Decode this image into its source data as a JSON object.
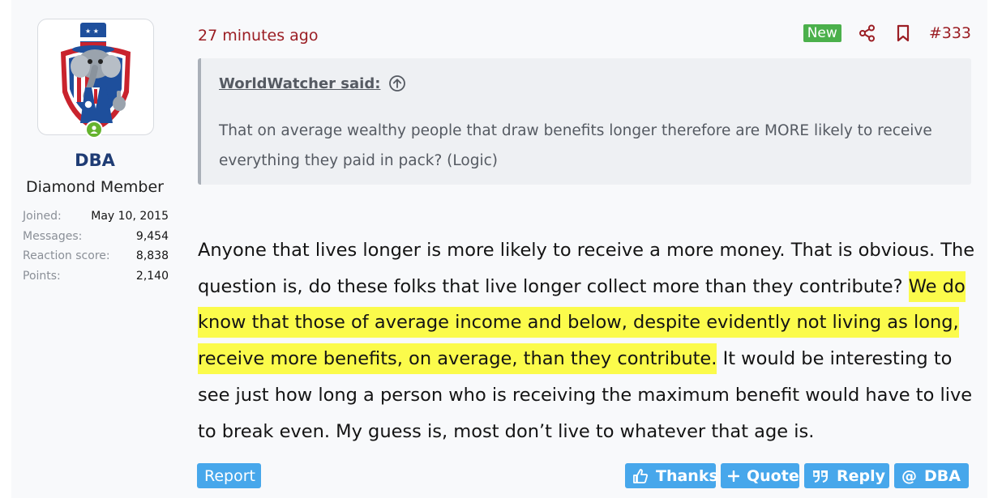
{
  "user": {
    "username": "DBA",
    "title": "Diamond Member",
    "stats": [
      {
        "label": "Joined:",
        "value": "May 10, 2015"
      },
      {
        "label": "Messages:",
        "value": "9,454"
      },
      {
        "label": "Reaction score:",
        "value": "8,838"
      },
      {
        "label": "Points:",
        "value": "2,140"
      }
    ]
  },
  "post": {
    "time": "27 minutes ago",
    "badge": "New",
    "number": "#333",
    "quote": {
      "author": "WorldWatcher said:",
      "text": "That on average wealthy people that draw benefits longer therefore are MORE likely to receive everything they paid in pack? (Logic)"
    },
    "message": {
      "before": "Anyone that lives longer is more likely to receive a more money. That is obvious. The question is, do these folks that live longer collect more than they contribute?",
      "highlighted": "We do know that those of average income and below, despite evidently not living as long, receive more benefits, on average, than they contribute.",
      "after": "It would be interesting to see just how long a person who is receiving the maximum benefit would have to live to break even. My guess is, most don’t live to whatever that age is."
    }
  },
  "footer": {
    "report": "Report",
    "thanks": "Thanks",
    "quote": "Quote",
    "reply": "Reply",
    "mention": "DBA"
  },
  "colors": {
    "accent_button": "#47a7eb",
    "highlight": "#fbfb4b",
    "badge_new": "#4bb04b",
    "username": "#1f3c74",
    "time": "#9b1e24"
  }
}
